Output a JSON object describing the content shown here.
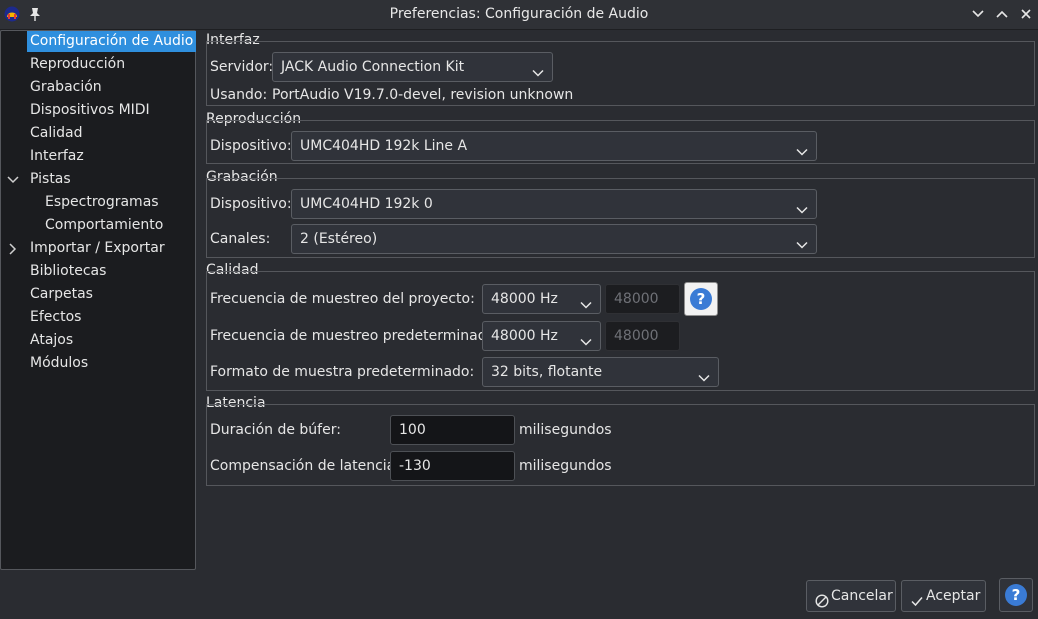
{
  "window": {
    "title": "Preferencias: Configuración de Audio"
  },
  "sidebar": {
    "items": [
      {
        "label": "Configuración de Audio"
      },
      {
        "label": "Reproducción"
      },
      {
        "label": "Grabación"
      },
      {
        "label": "Dispositivos MIDI"
      },
      {
        "label": "Calidad"
      },
      {
        "label": "Interfaz"
      },
      {
        "label": "Pistas"
      },
      {
        "label": "Espectrogramas"
      },
      {
        "label": "Comportamiento"
      },
      {
        "label": "Importar / Exportar"
      },
      {
        "label": "Bibliotecas"
      },
      {
        "label": "Carpetas"
      },
      {
        "label": "Efectos"
      },
      {
        "label": "Atajos"
      },
      {
        "label": "Módulos"
      }
    ]
  },
  "interface": {
    "title": "Interfaz",
    "host_label": "Servidor:",
    "host_value": "JACK Audio Connection Kit",
    "using_label": "Usando:",
    "using_value": "PortAudio V19.7.0-devel, revision unknown"
  },
  "playback": {
    "title": "Reproducción",
    "device_label": "Dispositivo:",
    "device_value": "UMC404HD 192k Line A"
  },
  "recording": {
    "title": "Grabación",
    "device_label": "Dispositivo:",
    "device_value": "UMC404HD 192k 0",
    "channels_label": "Canales:",
    "channels_value": "2 (Estéreo)"
  },
  "quality": {
    "title": "Calidad",
    "project_rate_label": "Frecuencia de muestreo del proyecto:",
    "project_rate_value": "48000 Hz",
    "project_rate_custom": "48000",
    "default_rate_label": "Frecuencia de muestreo predeterminada:",
    "default_rate_value": "48000 Hz",
    "default_rate_custom": "48000",
    "format_label": "Formato de muestra predeterminado:",
    "format_value": "32 bits, flotante"
  },
  "latency": {
    "title": "Latencia",
    "buffer_label": "Duración de búfer:",
    "buffer_value": "100",
    "buffer_unit": "milisegundos",
    "comp_label": "Compensación de latencia:",
    "comp_value": "-130",
    "comp_unit": "milisegundos"
  },
  "footer": {
    "cancel_label": "Cancelar",
    "ok_label": "Aceptar"
  },
  "colors": {
    "accent": "#2f8fde",
    "background": "#2a2c31",
    "sidebar_bg": "#1b1c1f",
    "help_blue": "#3a7bd5"
  }
}
